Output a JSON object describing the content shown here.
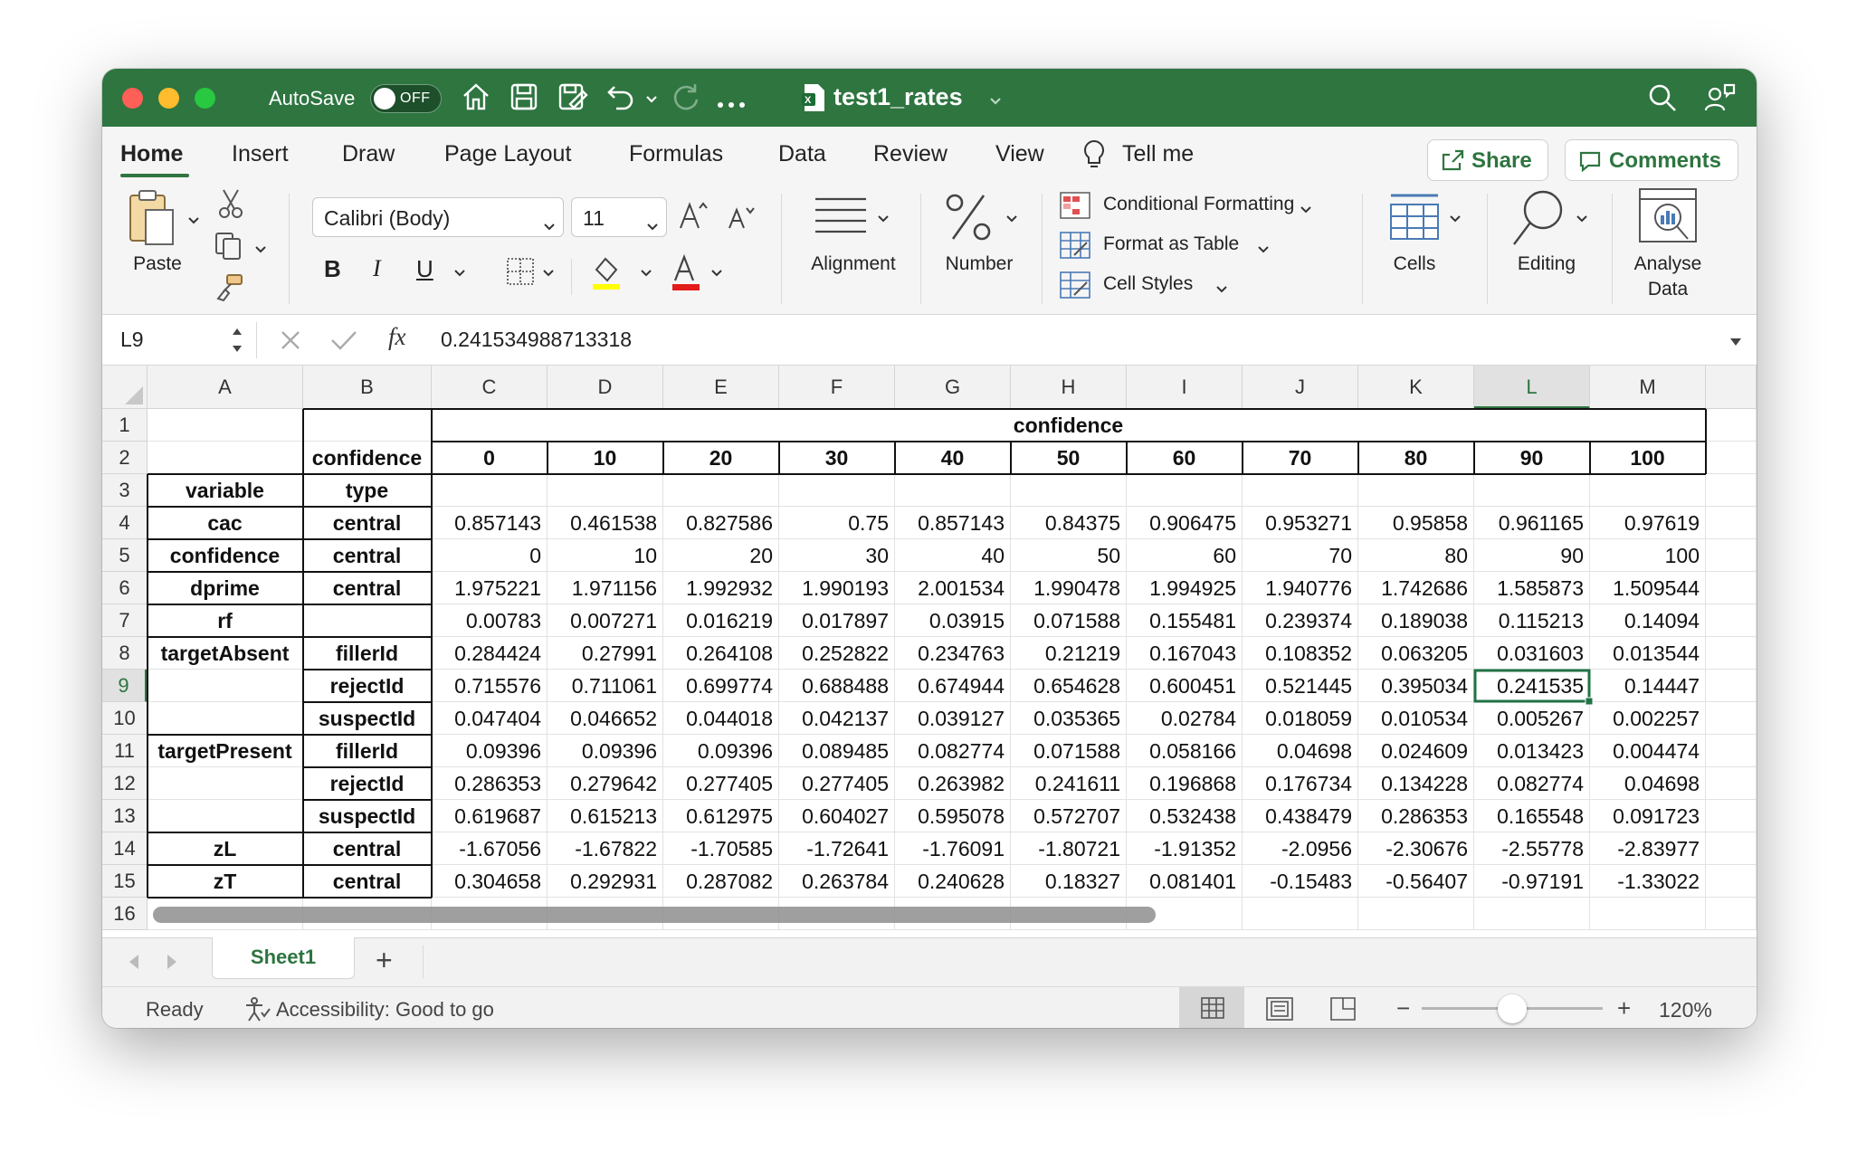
{
  "title_bar": {
    "autosave_label": "AutoSave",
    "autosave_state": "OFF",
    "document_title": "test1_rates",
    "colors": {
      "bar": "#2e7540",
      "close": "#fe5f57",
      "minimize": "#febc2e",
      "maximize": "#28c840"
    }
  },
  "ribbon_tabs": [
    "Home",
    "Insert",
    "Draw",
    "Page Layout",
    "Formulas",
    "Data",
    "Review",
    "View"
  ],
  "tell_me": "Tell me",
  "share_label": "Share",
  "comments_label": "Comments",
  "ribbon": {
    "paste_label": "Paste",
    "font_name": "Calibri (Body)",
    "font_size": "11",
    "bold": "B",
    "italic": "I",
    "underline": "U",
    "alignment_label": "Alignment",
    "number_label": "Number",
    "conditional_formatting": "Conditional Formatting",
    "format_as_table": "Format as Table",
    "cell_styles": "Cell Styles",
    "cells_label": "Cells",
    "editing_label": "Editing",
    "analyse_data_label_1": "Analyse",
    "analyse_data_label_2": "Data"
  },
  "formula_bar": {
    "name_box": "L9",
    "fx": "fx",
    "formula": "0.241534988713318"
  },
  "columns": [
    "A",
    "B",
    "C",
    "D",
    "E",
    "F",
    "G",
    "H",
    "I",
    "J",
    "K",
    "L",
    "M"
  ],
  "rows": [
    "1",
    "2",
    "3",
    "4",
    "5",
    "6",
    "7",
    "8",
    "9",
    "10",
    "11",
    "12",
    "13",
    "14",
    "15",
    "16"
  ],
  "sheet": {
    "header_confidence": "confidence",
    "header_row": [
      "confidence",
      "0",
      "10",
      "20",
      "30",
      "40",
      "50",
      "60",
      "70",
      "80",
      "90",
      "100"
    ],
    "label_variable": "variable",
    "label_type": "type",
    "data_rows": [
      {
        "a": "cac",
        "b": "central",
        "values": [
          "0.857143",
          "0.461538",
          "0.827586",
          "0.75",
          "0.857143",
          "0.84375",
          "0.906475",
          "0.953271",
          "0.95858",
          "0.961165",
          "0.97619"
        ]
      },
      {
        "a": "confidence",
        "b": "central",
        "values": [
          "0",
          "10",
          "20",
          "30",
          "40",
          "50",
          "60",
          "70",
          "80",
          "90",
          "100"
        ]
      },
      {
        "a": "dprime",
        "b": "central",
        "values": [
          "1.975221",
          "1.971156",
          "1.992932",
          "1.990193",
          "2.001534",
          "1.990478",
          "1.994925",
          "1.940776",
          "1.742686",
          "1.585873",
          "1.509544"
        ]
      },
      {
        "a": "rf",
        "b": "",
        "values": [
          "0.00783",
          "0.007271",
          "0.016219",
          "0.017897",
          "0.03915",
          "0.071588",
          "0.155481",
          "0.239374",
          "0.189038",
          "0.115213",
          "0.14094"
        ]
      },
      {
        "a": "targetAbsent",
        "b": "fillerId",
        "values": [
          "0.284424",
          "0.27991",
          "0.264108",
          "0.252822",
          "0.234763",
          "0.21219",
          "0.167043",
          "0.108352",
          "0.063205",
          "0.031603",
          "0.013544"
        ]
      },
      {
        "a": "",
        "b": "rejectId",
        "values": [
          "0.715576",
          "0.711061",
          "0.699774",
          "0.688488",
          "0.674944",
          "0.654628",
          "0.600451",
          "0.521445",
          "0.395034",
          "0.241535",
          "0.14447"
        ]
      },
      {
        "a": "",
        "b": "suspectId",
        "values": [
          "0.047404",
          "0.046652",
          "0.044018",
          "0.042137",
          "0.039127",
          "0.035365",
          "0.02784",
          "0.018059",
          "0.010534",
          "0.005267",
          "0.002257"
        ]
      },
      {
        "a": "targetPresent",
        "b": "fillerId",
        "values": [
          "0.09396",
          "0.09396",
          "0.09396",
          "0.089485",
          "0.082774",
          "0.071588",
          "0.058166",
          "0.04698",
          "0.024609",
          "0.013423",
          "0.004474"
        ]
      },
      {
        "a": "",
        "b": "rejectId",
        "values": [
          "0.286353",
          "0.279642",
          "0.277405",
          "0.277405",
          "0.263982",
          "0.241611",
          "0.196868",
          "0.176734",
          "0.134228",
          "0.082774",
          "0.04698"
        ]
      },
      {
        "a": "",
        "b": "suspectId",
        "values": [
          "0.619687",
          "0.615213",
          "0.612975",
          "0.604027",
          "0.595078",
          "0.572707",
          "0.532438",
          "0.438479",
          "0.286353",
          "0.165548",
          "0.091723"
        ]
      },
      {
        "a": "zL",
        "b": "central",
        "values": [
          "-1.67056",
          "-1.67822",
          "-1.70585",
          "-1.72641",
          "-1.76091",
          "-1.80721",
          "-1.91352",
          "-2.0956",
          "-2.30676",
          "-2.55778",
          "-2.83977"
        ]
      },
      {
        "a": "zT",
        "b": "central",
        "values": [
          "0.304658",
          "0.292931",
          "0.287082",
          "0.263784",
          "0.240628",
          "0.18327",
          "0.081401",
          "-0.15483",
          "-0.56407",
          "-0.97191",
          "-1.33022"
        ]
      }
    ]
  },
  "sheet_tab": "Sheet1",
  "add_sheet": "+",
  "status": {
    "ready": "Ready",
    "accessibility": "Accessibility: Good to go",
    "zoom": "120%",
    "zoom_minus": "−",
    "zoom_plus": "+"
  }
}
